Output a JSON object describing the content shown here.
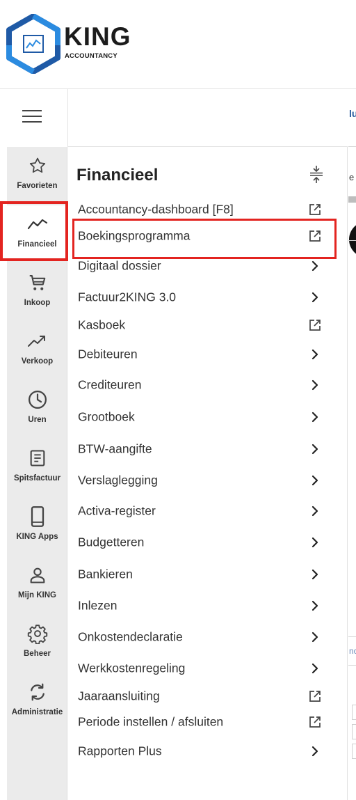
{
  "brand": {
    "name": "KING",
    "sub": "ACCOUNTANCY",
    "color_primary": "#1f5aa6",
    "color_secondary": "#2b8be0"
  },
  "rail": {
    "items": [
      {
        "id": "favorieten",
        "label": "Favorieten",
        "icon": "star-icon"
      },
      {
        "id": "financieel",
        "label": "Financieel",
        "icon": "trend-line-icon",
        "active": true
      },
      {
        "id": "inkoop",
        "label": "Inkoop",
        "icon": "cart-icon"
      },
      {
        "id": "verkoop",
        "label": "Verkoop",
        "icon": "trending-up-icon"
      },
      {
        "id": "uren",
        "label": "Uren",
        "icon": "clock-icon"
      },
      {
        "id": "spitsfactuur",
        "label": "Spitsfactuur",
        "icon": "document-icon"
      },
      {
        "id": "king-apps",
        "label": "KING Apps",
        "icon": "phone-icon"
      },
      {
        "id": "mijn-king",
        "label": "Mijn KING",
        "icon": "user-icon"
      },
      {
        "id": "beheer",
        "label": "Beheer",
        "icon": "gear-icon"
      },
      {
        "id": "administratie",
        "label": "Administratie",
        "icon": "sync-icon"
      }
    ]
  },
  "panel": {
    "title": "Financieel",
    "items": [
      {
        "label": "Accountancy-dashboard [F8]",
        "action": "external-link-icon"
      },
      {
        "label": "Boekingsprogramma",
        "action": "external-link-icon"
      },
      {
        "label": "Digitaal dossier",
        "action": "chevron-right-icon"
      },
      {
        "label": "Factuur2KING 3.0",
        "action": "chevron-right-icon"
      },
      {
        "label": "Kasboek",
        "action": "external-link-icon"
      },
      {
        "label": "Debiteuren",
        "action": "chevron-right-icon"
      },
      {
        "label": "Crediteuren",
        "action": "chevron-right-icon"
      },
      {
        "label": "Grootboek",
        "action": "chevron-right-icon"
      },
      {
        "label": "BTW-aangifte",
        "action": "chevron-right-icon"
      },
      {
        "label": "Verslaglegging",
        "action": "chevron-right-icon"
      },
      {
        "label": "Activa-register",
        "action": "chevron-right-icon"
      },
      {
        "label": "Budgetteren",
        "action": "chevron-right-icon"
      },
      {
        "label": "Bankieren",
        "action": "chevron-right-icon"
      },
      {
        "label": "Inlezen",
        "action": "chevron-right-icon"
      },
      {
        "label": "Onkostendeclaratie",
        "action": "chevron-right-icon"
      },
      {
        "label": "Werkkostenregeling",
        "action": "chevron-right-icon"
      },
      {
        "label": "Jaaraansluiting",
        "action": "external-link-icon"
      },
      {
        "label": "Periode instellen / afsluiten",
        "action": "external-link-icon"
      },
      {
        "label": "Rapporten Plus",
        "action": "chevron-right-icon"
      }
    ]
  },
  "right_partial": {
    "header_fragment": "lu",
    "row_fragment": "e",
    "link_fragment": "nc"
  },
  "colors": {
    "highlight": "#e32420",
    "rail_bg": "#ebebeb"
  }
}
